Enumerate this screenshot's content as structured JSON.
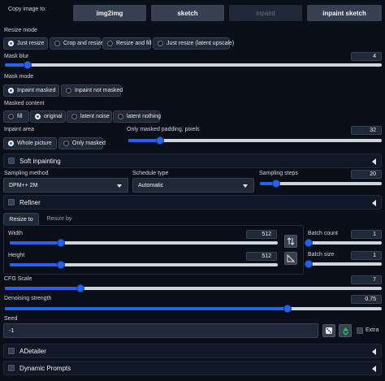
{
  "copy_image": {
    "label": "Copy image to:",
    "buttons": [
      "img2img",
      "sketch",
      "inpaint",
      "inpaint sketch"
    ]
  },
  "resize_mode": {
    "label": "Resize mode",
    "options": [
      "Just resize",
      "Crop and resize",
      "Resize and fill",
      "Just resize (latent upscale)"
    ],
    "selected": "Just resize"
  },
  "mask_blur": {
    "label": "Mask blur",
    "value": "4",
    "fraction": 0.06
  },
  "mask_mode": {
    "label": "Mask mode",
    "options": [
      "Inpaint masked",
      "Inpaint not masked"
    ],
    "selected": "Inpaint masked"
  },
  "masked_content": {
    "label": "Masked content",
    "options": [
      "fill",
      "original",
      "latent noise",
      "latent nothing"
    ],
    "selected": "original"
  },
  "inpaint_area": {
    "label": "Inpaint area",
    "options": [
      "Whole picture",
      "Only masked"
    ],
    "selected": "Whole picture"
  },
  "only_masked_padding": {
    "label": "Only masked padding, pixels",
    "value": "32",
    "fraction": 0.125
  },
  "soft_inpainting": {
    "label": "Soft inpainting"
  },
  "sampling_method": {
    "label": "Sampling method",
    "value": "DPM++ 2M"
  },
  "schedule_type": {
    "label": "Schedule type",
    "value": "Automatic"
  },
  "sampling_steps": {
    "label": "Sampling steps",
    "value": "20",
    "fraction": 0.13
  },
  "refiner": {
    "label": "Refiner"
  },
  "resize_tabs": {
    "tabs": [
      "Resize to",
      "Resize by"
    ],
    "active": "Resize to"
  },
  "width": {
    "label": "Width",
    "value": "512",
    "fraction": 0.19
  },
  "height": {
    "label": "Height",
    "value": "512",
    "fraction": 0.19
  },
  "batch_count": {
    "label": "Batch count",
    "value": "1",
    "fraction": 0.0
  },
  "batch_size": {
    "label": "Batch size",
    "value": "1",
    "fraction": 0.0
  },
  "cfg_scale": {
    "label": "CFG Scale",
    "value": "7",
    "fraction": 0.2
  },
  "denoising_strength": {
    "label": "Denoising strength",
    "value": "0.75",
    "fraction": 0.75
  },
  "seed": {
    "label": "Seed",
    "value": "-1",
    "extra_label": "Extra"
  },
  "adetailer": {
    "label": "ADetailer"
  },
  "dynamic_prompts": {
    "label": "Dynamic Prompts"
  },
  "icons": {
    "swap": "swap-arrows-icon",
    "aspect": "aspect-ratio-icon",
    "dice": "dice-icon",
    "recycle": "recycle-icon",
    "collapse": "collapse-triangle-icon"
  },
  "colors": {
    "accent": "#2563eb",
    "background": "#0b0f19",
    "button": "#374151",
    "track": "#d1d5db"
  }
}
